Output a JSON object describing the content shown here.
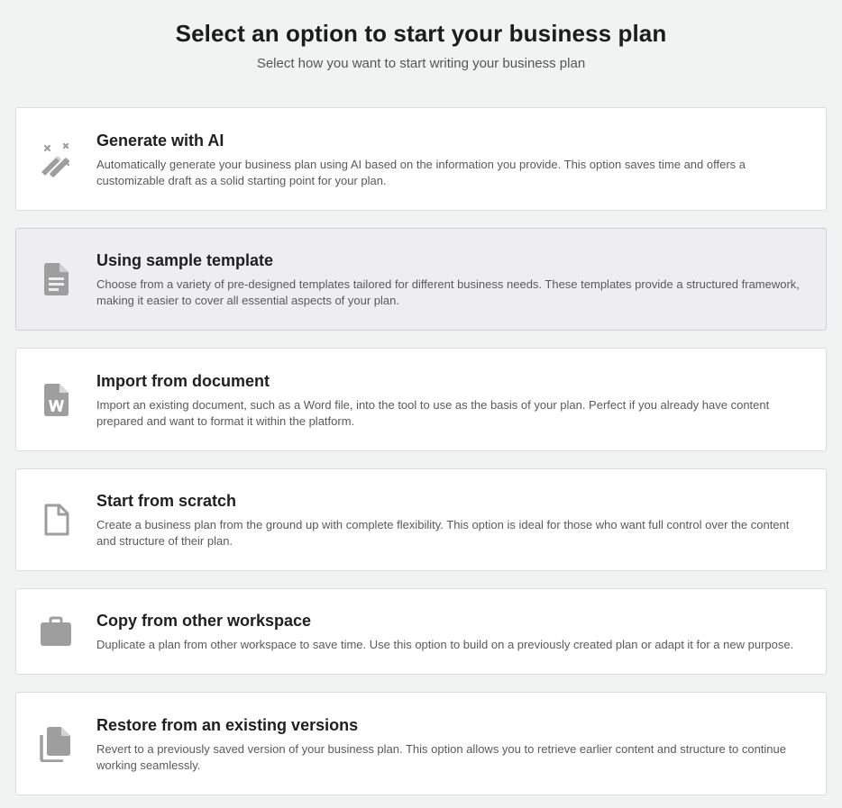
{
  "header": {
    "title": "Select an option to start your business plan",
    "subtitle": "Select how you want to start writing your business plan"
  },
  "options": [
    {
      "title": "Generate with AI",
      "description": "Automatically generate your business plan using AI based on the information you provide. This option saves time and offers a customizable draft as a solid starting point for your plan.",
      "icon": "magic-wand-icon",
      "selected": false
    },
    {
      "title": "Using sample template",
      "description": "Choose from a variety of pre-designed templates tailored for different business needs. These templates provide a structured framework, making it easier to cover all essential aspects of your plan.",
      "icon": "document-text-icon",
      "selected": true
    },
    {
      "title": "Import from document",
      "description": "Import an existing document, such as a Word file, into the tool to use as the basis of your plan. Perfect if you already have content prepared and want to format it within the platform.",
      "icon": "word-file-icon",
      "selected": false
    },
    {
      "title": "Start from scratch",
      "description": "Create a business plan from the ground up with complete flexibility. This option is ideal for those who want full control over the content and structure of their plan.",
      "icon": "blank-file-icon",
      "selected": false
    },
    {
      "title": "Copy from other workspace",
      "description": "Duplicate a plan from other workspace to save time. Use this option to build on a previously created plan or adapt it for a new purpose.",
      "icon": "briefcase-icon",
      "selected": false
    },
    {
      "title": "Restore from an existing versions",
      "description": "Revert to a previously saved version of your business plan. This option allows you to retrieve earlier content and structure to continue working seamlessly.",
      "icon": "file-copy-icon",
      "selected": false
    }
  ],
  "colors": {
    "background": "#f1f2f2",
    "card": "#ffffff",
    "card_selected": "#eeeef0",
    "icon": "#9e9e9e"
  }
}
